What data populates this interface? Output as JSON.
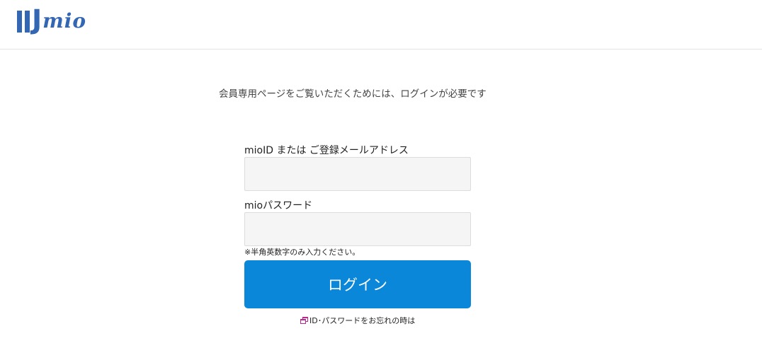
{
  "header": {
    "logo": {
      "letters_j": "J",
      "letters_mio": "mio"
    }
  },
  "main": {
    "message": "会員専用ページをご覧いただくためには、ログインが必要です",
    "id_field": {
      "label": "mioID または ご登録メールアドレス",
      "value": "",
      "placeholder": ""
    },
    "password_field": {
      "label": "mioパスワード",
      "value": "",
      "placeholder": ""
    },
    "note": "※半角英数字のみ入力ください。",
    "login_button": "ログイン",
    "forgot_link": "ID･パスワードをお忘れの時は",
    "forgot_link_icon": "external-window-icon"
  },
  "colors": {
    "brand": "#3366b3",
    "button": "#0a87d8",
    "link_icon": "#c0268f"
  }
}
